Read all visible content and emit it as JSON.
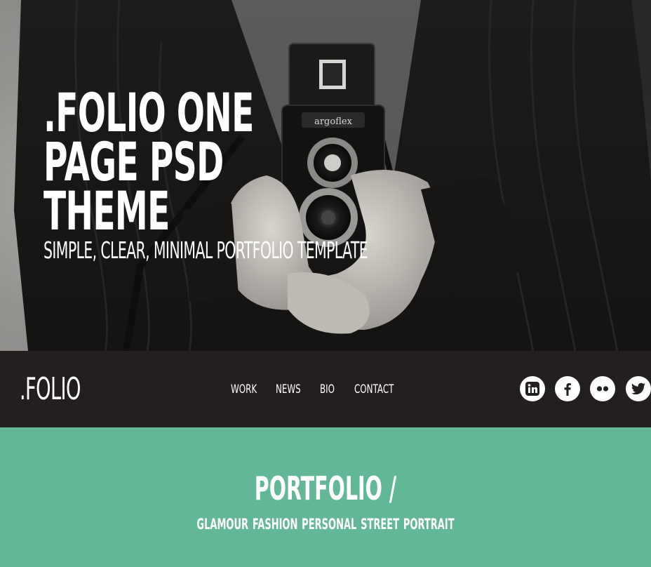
{
  "hero": {
    "title": ".FOLIO ONE\nPAGE PSD\nTHEME",
    "subtitle": "SIMPLE, CLEAR, MINIMAL PORTFOLIO TEMPLATE"
  },
  "navbar": {
    "logo": ".FOLIO",
    "links": [
      "WORK",
      "NEWS",
      "BIO",
      "CONTACT"
    ],
    "social": [
      "linkedin-icon",
      "facebook-icon",
      "flickr-icon",
      "twitter-icon"
    ]
  },
  "portfolio": {
    "title": "PORTFOLIO /",
    "categories": "GLAMOUR FASHION PERSONAL STREET PORTRAIT"
  },
  "colors": {
    "nav_bg": "#231f1e",
    "accent_green": "#62b896",
    "text": "#ffffff"
  }
}
